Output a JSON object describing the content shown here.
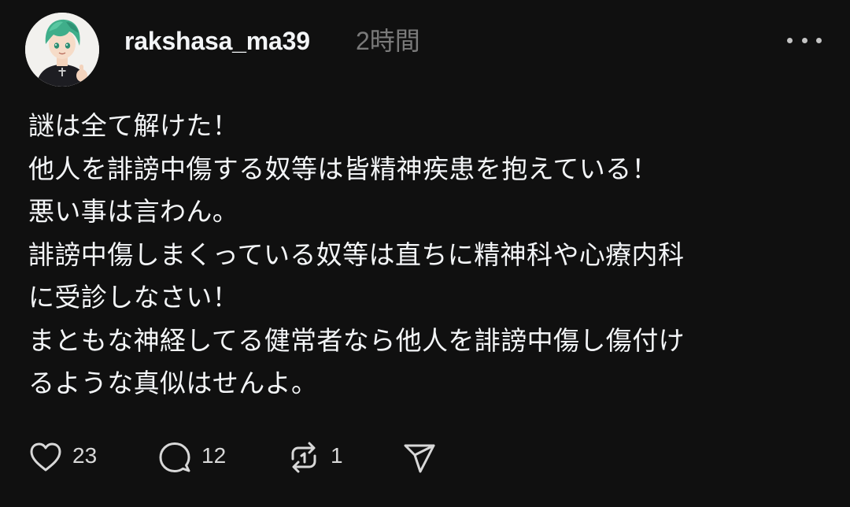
{
  "post": {
    "author": {
      "username": "rakshasa_ma39",
      "avatar": "anime-character-green-hair"
    },
    "timestamp": "2時間",
    "more_icon": "more-horizontal-icon",
    "body_lines": [
      "謎は全て解けた！",
      "他人を誹謗中傷する奴等は皆精神疾患を抱えている！",
      "悪い事は言わん。",
      "誹謗中傷しまくっている奴等は直ちに精神科や心療内科",
      "に受診しなさい！",
      "まともな神経してる健常者なら他人を誹謗中傷し傷付け",
      "るような真似はせんよ。"
    ],
    "actions": {
      "like": {
        "icon": "heart-icon",
        "count": "23"
      },
      "reply": {
        "icon": "comment-bubble-icon",
        "count": "12"
      },
      "repost": {
        "icon": "repost-icon",
        "count": "1"
      },
      "share": {
        "icon": "send-icon"
      }
    }
  },
  "colors": {
    "background": "#101010",
    "text_primary": "#f3f5f7",
    "text_secondary": "#7a7a7a",
    "icon": "#d8d8d8",
    "avatar_hair": "#3fae8a"
  }
}
